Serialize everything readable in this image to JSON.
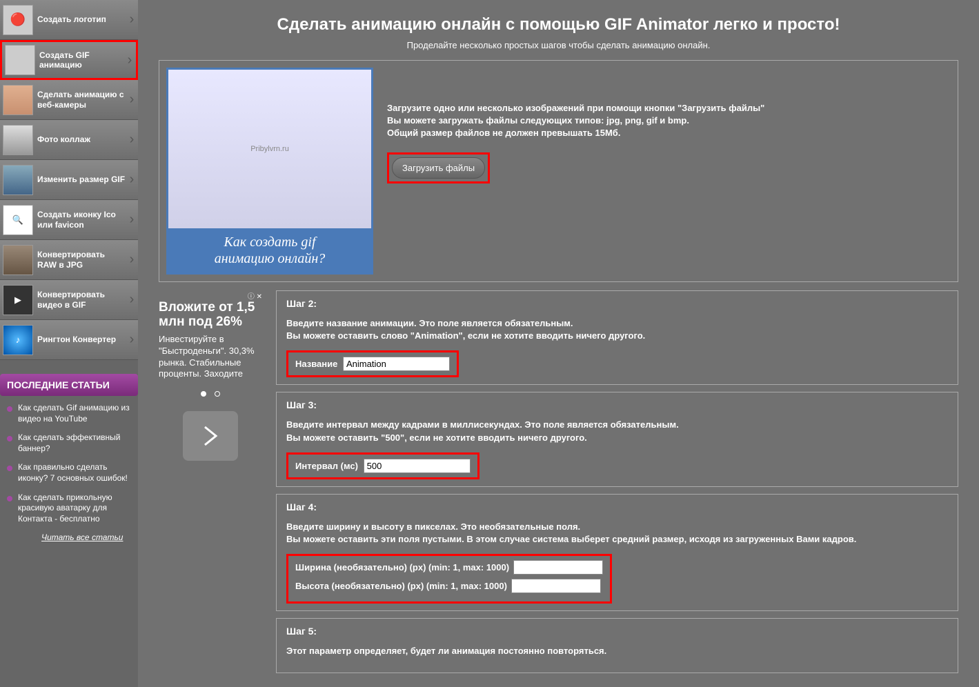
{
  "nav": {
    "items": [
      {
        "label": "Создать логотип"
      },
      {
        "label": "Создать GIF анимацию"
      },
      {
        "label": "Сделать анимацию с веб-камеры"
      },
      {
        "label": "Фото коллаж"
      },
      {
        "label": "Изменить размер GIF"
      },
      {
        "label": "Создать иконку Ico или favicon"
      },
      {
        "label": "Конвертировать RAW в JPG"
      },
      {
        "label": "Конвертировать видео в GIF"
      },
      {
        "label": "Рингтон Конвертер"
      }
    ]
  },
  "sidebar_section": "ПОСЛЕДНИЕ СТАТЬИ",
  "articles": [
    "Как сделать Gif анимацию из видео на YouTube",
    "Как сделать эффективный баннер?",
    "Как правильно сделать иконку? 7 основных ошибок!",
    "Как сделать прикольную красивую аватарку для Контакта - бесплатно"
  ],
  "read_all": "Читать все статьи",
  "title": "Сделать анимацию онлайн с помощью GIF Animator легко и просто!",
  "subtitle": "Проделайте несколько простых шагов чтобы сделать анимацию онлайн.",
  "preview_caption_1": "Как создать gif",
  "preview_caption_2": "анимацию онлайн?",
  "upload_line1": "Загрузите одно или несколько изображений при помощи кнопки \"Загрузить файлы\"",
  "upload_line2": "Вы можете загружать файлы следующих типов: jpg, png, gif и bmp.",
  "upload_line3": "Общий размер файлов не должен превышать 15Мб.",
  "upload_btn": "Загрузить файлы",
  "ad": {
    "info": "ⓘ ✕",
    "title": "Вложите от 1,5 млн под 26%",
    "text": "Инвестируйте в \"Быстроденьги\". 30,3% рынка. Стабильные проценты. Заходите"
  },
  "step2": {
    "title": "Шаг 2:",
    "desc1": "Введите название анимации. Это поле является обязательным.",
    "desc2": "Вы можете оставить слово \"Animation\", если не хотите вводить ничего другого.",
    "label": "Название",
    "value": "Animation"
  },
  "step3": {
    "title": "Шаг 3:",
    "desc1": "Введите интервал между кадрами в миллисекундах. Это поле является обязательным.",
    "desc2": "Вы можете оставить \"500\", если не хотите вводить ничего другого.",
    "label": "Интервал (мс)",
    "value": "500"
  },
  "step4": {
    "title": "Шаг 4:",
    "desc1": "Введите ширину и высоту в пикселах. Это необязательные поля.",
    "desc2": "Вы можете оставить эти поля пустыми. В этом случае система выберет средний размер, исходя из загруженных Вами кадров.",
    "width_label": "Ширина (необязательно) (px) (min: 1, max: 1000)",
    "height_label": "Высота (необязательно) (px) (min: 1, max: 1000)"
  },
  "step5": {
    "title": "Шаг 5:",
    "desc": "Этот параметр определяет, будет ли анимация постоянно повторяться."
  }
}
